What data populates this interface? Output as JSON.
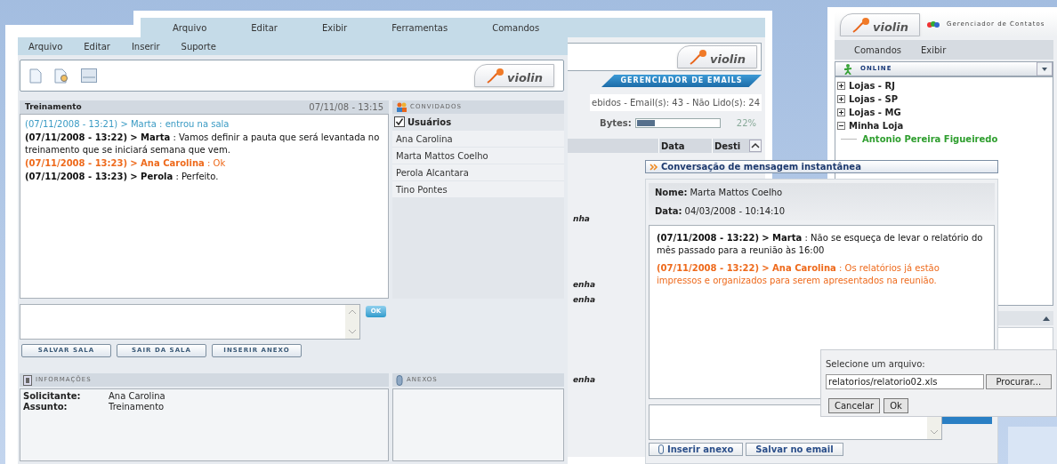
{
  "email_window": {
    "menu": [
      "Arquivo",
      "Editar",
      "Exibir",
      "Ferramentas",
      "Comandos"
    ],
    "logo": "violin",
    "tab": "GERENCIADOR DE EMAILS",
    "summary": "ebidos - Email(s): 43 - Não Lido(s): 24",
    "bytes": {
      "label": "Bytes:",
      "level": 0.22,
      "reading": "22%"
    },
    "columns": [
      "Data",
      "Desti"
    ],
    "cell_fragments": [
      "nha",
      "enha",
      "enha",
      "enha"
    ]
  },
  "chat_window": {
    "menu": [
      "Arquivo",
      "Editar",
      "Inserir",
      "Suporte"
    ],
    "logo": "violin",
    "room": {
      "title": "Treinamento",
      "date": "07/11/08 - 13:15"
    },
    "messages": [
      {
        "kind": "event",
        "time": "(07/11/2008 - 13:21)",
        "sender": "> Marta",
        "text": ": entrou na sala"
      },
      {
        "kind": "own",
        "time": "(07/11/2008 - 13:22)",
        "sender": "> Marta",
        "text": ": Vamos definir a pauta que será levantada no treinamento que se iniciará semana que vem."
      },
      {
        "kind": "reply",
        "time": "(07/11/2008 - 13:23)",
        "sender": "> Ana Carolina",
        "text": ": Ok"
      },
      {
        "kind": "own",
        "time": "(07/11/2008 - 13:23)",
        "sender": "> Perola",
        "text": ": Perfeito."
      }
    ],
    "send_button": "OK",
    "guests": {
      "title": "CONVIDADOS",
      "header": {
        "label": "Usuários",
        "checked": true
      },
      "users": [
        "Ana Carolina",
        "Marta Mattos Coelho",
        "Perola Alcantara",
        "Tino Pontes"
      ]
    },
    "buttons": [
      "SALVAR SALA",
      "SAIR DA SALA",
      "INSERIR ANEXO"
    ],
    "info": {
      "title": "INFORMAÇÕES",
      "fields": [
        {
          "label": "Solicitante:",
          "value": "Ana Carolina"
        },
        {
          "label": "Assunto:",
          "value": "Treinamento"
        }
      ]
    },
    "attachments": {
      "title": "ANEXOS"
    }
  },
  "contacts_window": {
    "logo": "violin",
    "title": "Gerenciador de Contatos",
    "menu": [
      "Comandos",
      "Exibir"
    ],
    "status": "ONLINE",
    "groups": [
      {
        "label": "Lojas - RJ",
        "expanded": false
      },
      {
        "label": "Lojas - SP",
        "expanded": false
      },
      {
        "label": "Lojas - MG",
        "expanded": false
      },
      {
        "label": "Minha Loja",
        "expanded": true,
        "children": [
          {
            "label": "Antonio Pereira Figueiredo"
          }
        ]
      }
    ]
  },
  "im_window": {
    "title": "Conversação de mensagem instantânea",
    "name": {
      "label": "Nome:",
      "value": "Marta Mattos Coelho"
    },
    "date": {
      "label": "Data:",
      "value": "04/03/2008 - 10:14:10"
    },
    "messages": [
      {
        "kind": "own",
        "time": "(07/11/2008 - 13:22)",
        "sender": "> Marta",
        "text": ": Não se esqueça de levar o relatório do mês passado para a reunião às 16:00"
      },
      {
        "kind": "reply",
        "time": "(07/11/2008 - 13:22)",
        "sender": "> Ana Carolina",
        "text": ": Os relatórios já estão impressos e organizados para serem apresentados na reunião."
      }
    ],
    "buttons": [
      "Inserir anexo",
      "Salvar no email"
    ]
  },
  "file_dialog": {
    "label": "Selecione um arquivo:",
    "value": "relatorios/relatorio02.xls",
    "browse": "Procurar...",
    "buttons": [
      "Cancelar",
      "Ok"
    ]
  }
}
